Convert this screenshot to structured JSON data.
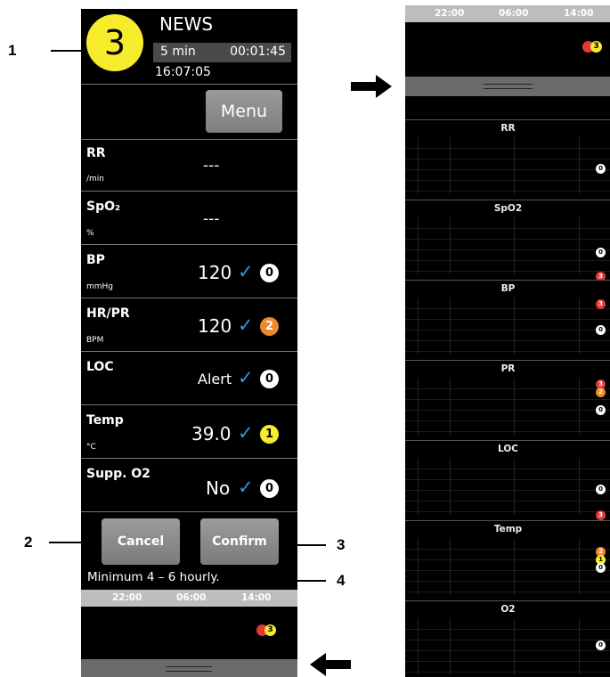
{
  "callouts": {
    "c1": "1",
    "c2": "2",
    "c3": "3",
    "c4": "4"
  },
  "news": {
    "title": "NEWS",
    "total_score": "3",
    "interval": "5 min",
    "countdown": "00:01:45",
    "clock": "16:07:05",
    "menu_label": "Menu"
  },
  "vitals": {
    "rr": {
      "label": "RR",
      "unit": "/min",
      "value": "---"
    },
    "spo2": {
      "label": "SpO₂",
      "unit": "%",
      "value": "---"
    },
    "bp": {
      "label": "BP",
      "unit": "mmHg",
      "value": "120",
      "score": "0"
    },
    "hr": {
      "label": "HR/PR",
      "unit": "BPM",
      "value": "120",
      "score": "2"
    },
    "loc": {
      "label": "LOC",
      "value": "Alert",
      "score": "0"
    },
    "temp": {
      "label": "Temp",
      "unit": "°C",
      "value": "39.0",
      "score": "1"
    },
    "o2": {
      "label": "Supp. O2",
      "value": "No",
      "score": "0"
    }
  },
  "actions": {
    "cancel_label": "Cancel",
    "confirm_label": "Confirm"
  },
  "frequency_note": "Minimum 4 – 6 hourly.",
  "timeline": {
    "times": [
      "22:00",
      "06:00",
      "14:00"
    ],
    "latest_score": "3"
  },
  "trend": {
    "sections": [
      "RR",
      "SpO2",
      "BP",
      "PR",
      "LOC",
      "Temp",
      "O2"
    ],
    "marker_scores": {
      "rr": [
        "0"
      ],
      "spo2": [
        "0",
        "3"
      ],
      "bp": [
        "3",
        "0"
      ],
      "pr": [
        "3",
        "2",
        "0"
      ],
      "loc": [
        "0",
        "3"
      ],
      "temp": [
        "2",
        "1",
        "0"
      ],
      "o2": [
        "0"
      ]
    }
  },
  "colors": {
    "score_yellow": "#f7ec2b",
    "score_orange": "#f0892d",
    "score_red": "#e13a3a",
    "check_blue": "#2a9be0"
  }
}
